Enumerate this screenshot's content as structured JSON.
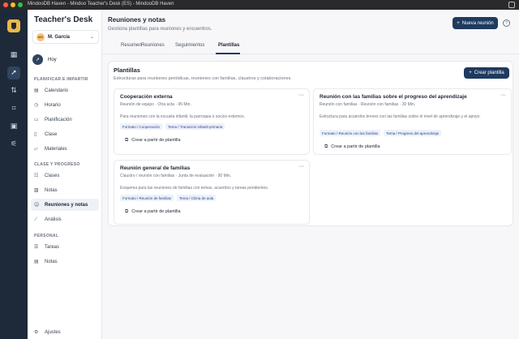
{
  "titlebar": {
    "text": "MindooDB Haven - Mindoo Teacher's Desk (ES) - MindooDB Haven"
  },
  "rail": {
    "icons": [
      "grid-icon",
      "rocket-icon",
      "swap-icon",
      "scan-icon",
      "image-icon",
      "sliders-icon"
    ]
  },
  "sidebar": {
    "brand": "Teacher's Desk",
    "user": {
      "initials": "MG",
      "name": "M. García"
    },
    "hoy": "Hoy",
    "section1": "PLANIFICAR E IMPARTIR",
    "plan_items": [
      "Calendario",
      "Horario",
      "Planificación",
      "Clase",
      "Materiales"
    ],
    "section2": "CLASE Y PROGRESO",
    "progress_items": [
      "Clases",
      "Notas",
      "Reuniones y notas",
      "Análisis"
    ],
    "section3": "PERSONAL",
    "personal_items": [
      "Tareas",
      "Notas"
    ],
    "settings": "Ajustes"
  },
  "header": {
    "title": "Reuniones y notas",
    "subtitle": "Gestiona plantillas para reuniones y encuentros.",
    "new_meeting": "Nueva reunión",
    "help": "?"
  },
  "tabs": [
    "Resumen",
    "Reuniones",
    "Seguimientos",
    "Plantillas"
  ],
  "panel": {
    "title": "Plantillas",
    "subtitle": "Estructuras para reuniones periódicas, reuniones con familias, claustros y colaboraciones.",
    "create_button": "Crear plantilla"
  },
  "cards": [
    {
      "title": "Cooperación externa",
      "meta": "Reunión de equipo · Otra acta · 45 Min.",
      "desc": "Para reuniones con la escuela infantil, la parroquia o socios externos.",
      "tags": [
        "Formato / Cooperación",
        "Tema / Transición infantil-primaria"
      ],
      "button": "Crear a partir de plantilla"
    },
    {
      "title": "Reunión con las familias sobre el progreso del aprendizaje",
      "meta": "Reunión con familias · Reunión con familias · 30 Min.",
      "desc": "Estructura para acuerdos breves con las familias sobre el nivel de aprendizaje y el apoyo.",
      "tags": [
        "Formato / Reunión con las familias",
        "Tema / Progreso del aprendizaje"
      ],
      "button": "Crear a partir de plantilla"
    },
    {
      "title": "Reunión general de familias",
      "meta": "Claustro / reunión con familias · Junta de evaluación · 90 Min.",
      "desc": "Esquema para las reuniones de familias con temas, acuerdos y tareas pendientes.",
      "tags": [
        "Formato / Reunión de familias",
        "Tema / Clima de aula"
      ],
      "button": "Crear a partir de plantilla"
    }
  ],
  "colors": {
    "accent": "#1f3a5f",
    "rail": "#1e2a3a",
    "tag_bg": "#edf1fb",
    "tag_text": "#2a4a85"
  }
}
